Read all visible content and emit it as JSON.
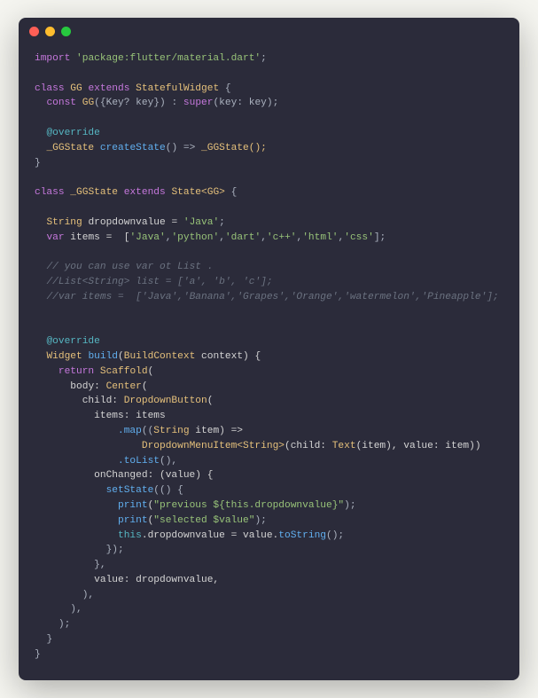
{
  "titlebar": {
    "dots": [
      "red",
      "yellow",
      "green"
    ]
  },
  "code": {
    "import_kw": "import",
    "import_str": "'package:flutter/material.dart'",
    "semi": ";",
    "class_kw": "class",
    "gg_name": "GG",
    "extends_kw": "extends",
    "stateful": "StatefulWidget",
    "lbrace": " {",
    "const_kw": "const",
    "gg_ctor": "GG",
    "ctor_params": "({Key? key}) : ",
    "super_kw": "super",
    "super_args": "(key: key);",
    "override": "@override",
    "ggstate_type": "_GGState",
    "createstate": "createState",
    "arrow_part": "() => ",
    "ggstate_ctor": "_GGState();",
    "rbrace": "}",
    "state_generic": "State",
    "gg_generic": "<GG>",
    "string_type": "String",
    "dropdownvalue_decl": " dropdownvalue = ",
    "java_str": "'Java'",
    "var_kw": "var",
    "items_decl": " items =  [",
    "item_java": "'Java'",
    "item_python": "'python'",
    "item_dart": "'dart'",
    "item_cpp": "'c++'",
    "item_html": "'html'",
    "item_css": "'css'",
    "comma": ",",
    "close_list": "];",
    "comment1": "// you can use var ot List .",
    "comment2": "//List<String> list = ['a', 'b', 'c'];",
    "comment3": "//var items =  ['Java','Banana','Grapes','Orange','watermelon','Pineapple'];",
    "widget_type": "Widget",
    "build_fn": "build",
    "buildcontext": "BuildContext",
    "context_param": " context) {",
    "return_kw": "return",
    "scaffold": "Scaffold",
    "body_label": "body: ",
    "center": "Center",
    "child_label": "child: ",
    "dropdownbutton": "DropdownButton",
    "items_label": "items: items",
    "map_fn": ".map",
    "map_params_open": "((",
    "string_t": "String",
    "item_param": " item) =>",
    "ddmenuitem": "DropdownMenuItem",
    "string_gen": "<String>",
    "child_text": "(child: ",
    "text_widget": "Text",
    "text_args": "(item), value: item))",
    "tolist": ".toList",
    "tolist_call": "(),",
    "onchanged": "onChanged: (value) {",
    "setstate": "setState",
    "setstate_open": "(() {",
    "print_fn": "print",
    "prev_str": "\"previous ${this.dropdownvalue}\"",
    "close_paren_semi": ");",
    "sel_str": "\"selected $value\"",
    "this_kw": "this",
    "assign": ".dropdownvalue = value.",
    "tostring": "toString",
    "tostring_call": "();",
    "close_setstate": "});",
    "close_onchanged": "},",
    "value_label": "value: dropdownvalue,",
    "close_dd": "),",
    "close_center": "),",
    "close_scaffold": ");",
    "close_build": "}"
  }
}
